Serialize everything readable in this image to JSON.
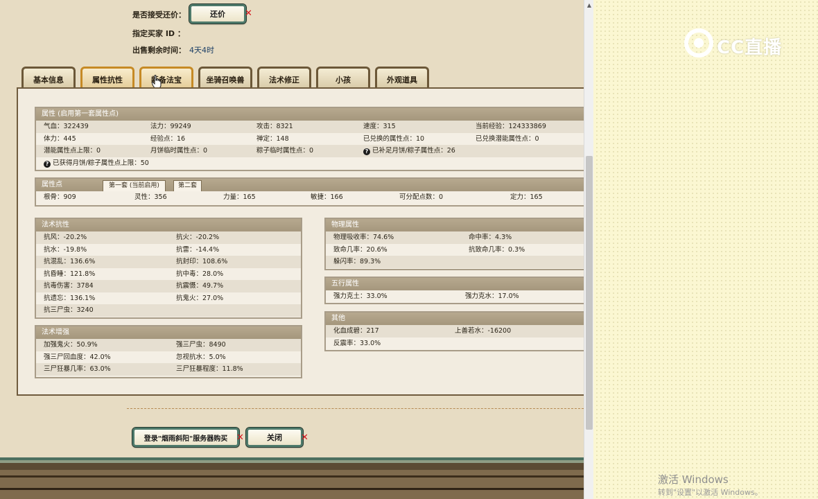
{
  "header": {
    "accept_counter_label": "是否接受还价：",
    "counter_offer_button": "还价",
    "buyer_id_label": "指定买家 ID ：",
    "remaining_time_label": "出售剩余时间：",
    "remaining_time_value": "4天4时"
  },
  "tabs": [
    {
      "label": "基本信息"
    },
    {
      "label": "属性抗性"
    },
    {
      "label": "新备法宝"
    },
    {
      "label": "坐骑召唤兽"
    },
    {
      "label": "法术修正"
    },
    {
      "label": "小孩"
    },
    {
      "label": "外观道具"
    }
  ],
  "attributes": {
    "title": "属性 (启用第一套属性点)",
    "row1": [
      "气血：322439",
      "法力：99249",
      "攻击：8321",
      "速度：315",
      "当前经验：124333869"
    ],
    "row2": [
      "体力：445",
      "经验点：16",
      "禅定：148",
      "已兑换的属性点：10",
      "已兑换潜能属性点：0"
    ],
    "row3": [
      "潜能属性点上限：0",
      "月饼临时属性点：0",
      "粽子临时属性点：0",
      "已补足月饼/粽子属性点：26"
    ],
    "row4": [
      "已获得月饼/粽子属性点上限：50"
    ]
  },
  "attr_points": {
    "title": "属性点",
    "subtab1": "第一套 (当前启用)",
    "subtab2": "第二套",
    "values": [
      "根骨：909",
      "灵性：356",
      "力量：165",
      "敏捷：166",
      "可分配点数：0",
      "定力：165"
    ]
  },
  "magic_resist": {
    "title": "法术抗性",
    "rows": [
      [
        "抗风：-20.2%",
        "抗火：-20.2%"
      ],
      [
        "抗水：-19.8%",
        "抗雷：-14.4%"
      ],
      [
        "抗混乱：136.6%",
        "抗封印：108.6%"
      ],
      [
        "抗昏睡：121.8%",
        "抗中毒：28.0%"
      ],
      [
        "抗毒伤害：3784",
        "抗震慑：49.7%"
      ],
      [
        "抗遗忘：136.1%",
        "抗鬼火：27.0%"
      ],
      [
        "抗三尸虫：3240",
        ""
      ]
    ]
  },
  "magic_boost": {
    "title": "法术增强",
    "rows": [
      [
        "加强鬼火：50.9%",
        "强三尸虫：8490"
      ],
      [
        "强三尸回血度：42.0%",
        "忽视抗水：5.0%"
      ],
      [
        "三尸狂暴几率：63.0%",
        "三尸狂暴程度：11.8%"
      ]
    ]
  },
  "physical": {
    "title": "物理属性",
    "rows": [
      [
        "物理吸收率：74.6%",
        "命中率：4.3%"
      ],
      [
        "致命几率：20.6%",
        "抗致命几率：0.3%"
      ],
      [
        "躲闪率：89.3%",
        ""
      ]
    ]
  },
  "five_elements": {
    "title": "五行属性",
    "rows": [
      [
        "强力克土：33.0%",
        "强力克水：17.0%"
      ]
    ]
  },
  "other": {
    "title": "其他",
    "rows": [
      [
        "化血成碧：217",
        "上善若水：-16200"
      ],
      [
        "反震率：33.0%",
        ""
      ]
    ]
  },
  "footer": {
    "buy_button": "登录\"烟雨斜阳\"服务器购买",
    "close_button": "关闭"
  },
  "watermarks": {
    "logo_text": "CC直播",
    "windows_line1": "激活 Windows",
    "windows_line2": "转到\"设置\"以激活 Windows。"
  },
  "colors": {
    "panel_bg": "#f2ece0",
    "section_header": "#a5977d",
    "button_border": "#4e7a6b",
    "active_tab_border": "#c68a25",
    "close_mark": "#d4161d"
  }
}
